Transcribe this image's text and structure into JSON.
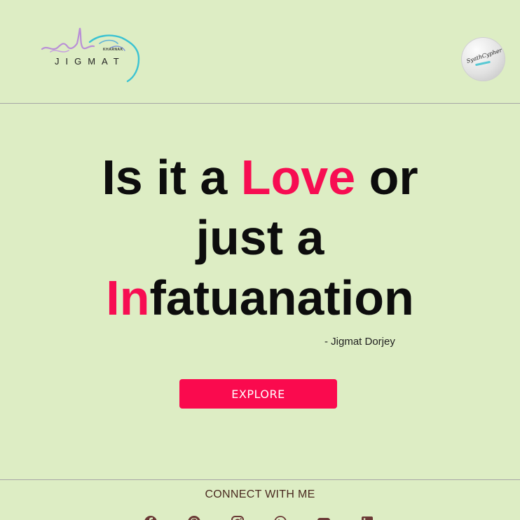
{
  "header": {
    "logo_text": "JIGMAT",
    "logo_subtext": "KHARNAK",
    "avatar_text": "SyathCypher"
  },
  "hero": {
    "line1_pre": "Is it a ",
    "line1_accent": "Love",
    "line1_post": " or",
    "line2": "just a",
    "line3_accent": "In",
    "line3_rest": "fatuanation",
    "attribution": "- Jigmat Dorjey",
    "button_label": "EXPLORE"
  },
  "footer": {
    "connect_label": "CONNECT WITH ME",
    "social_icons": [
      "facebook-icon",
      "pinterest-icon",
      "instagram-icon",
      "whatsapp-icon",
      "youtube-icon",
      "linkedin-icon"
    ]
  },
  "colors": {
    "background": "#ddedc4",
    "accent": "#f70d52",
    "button": "#fa0a4e",
    "text": "#0d0d0d",
    "footer_text": "#4a2a20",
    "icon": "#6b3a36"
  }
}
